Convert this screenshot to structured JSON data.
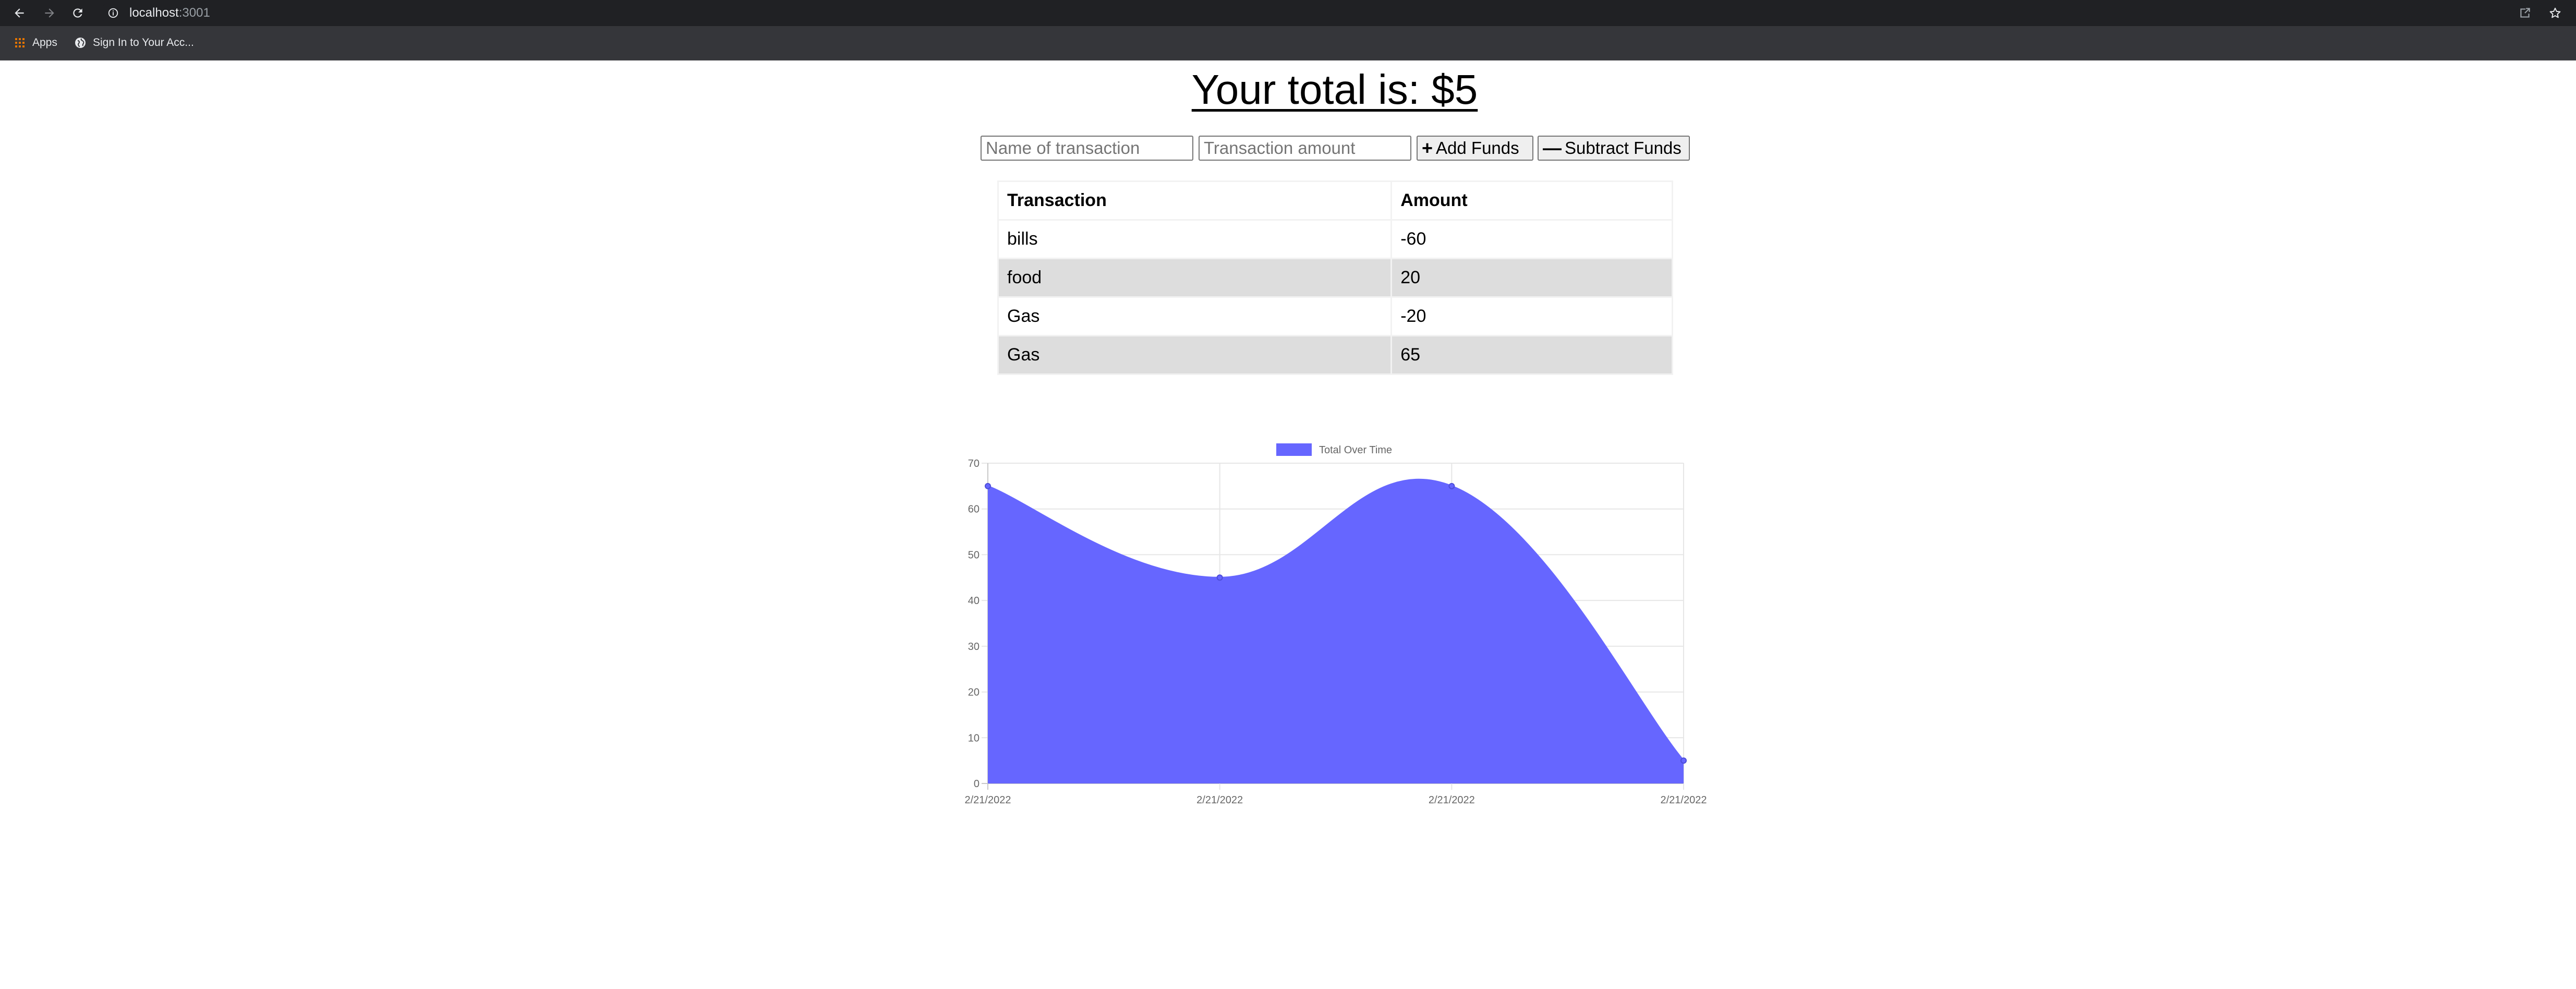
{
  "browser": {
    "url_host": "localhost",
    "url_port": ":3001",
    "bookmarks": [
      {
        "label": "Apps",
        "icon": "apps-grid-icon"
      },
      {
        "label": "Sign In to Your Acc...",
        "icon": "globe-icon"
      }
    ]
  },
  "header": {
    "total_text": "Your total is: $5"
  },
  "form": {
    "name_placeholder": "Name of transaction",
    "amount_placeholder": "Transaction amount",
    "name_value": "",
    "amount_value": "",
    "add_label": "Add Funds",
    "add_icon": "plus-icon",
    "subtract_label": "Subtract Funds",
    "subtract_icon": "minus-icon"
  },
  "table": {
    "columns": [
      "Transaction",
      "Amount"
    ],
    "rows": [
      {
        "name": "bills",
        "amount": "-60"
      },
      {
        "name": "food",
        "amount": "20"
      },
      {
        "name": "Gas",
        "amount": "-20"
      },
      {
        "name": "Gas",
        "amount": "65"
      }
    ]
  },
  "chart_data": {
    "type": "area",
    "x": [
      "2/21/2022",
      "2/21/2022",
      "2/21/2022",
      "2/21/2022"
    ],
    "series": [
      {
        "name": "Total Over Time",
        "values": [
          65,
          45,
          65,
          5
        ],
        "color": "#6666ff"
      }
    ],
    "yticks": [
      0,
      10,
      20,
      30,
      40,
      50,
      60,
      70
    ],
    "ylim": [
      0,
      70
    ],
    "grid": true,
    "legend": "top"
  }
}
